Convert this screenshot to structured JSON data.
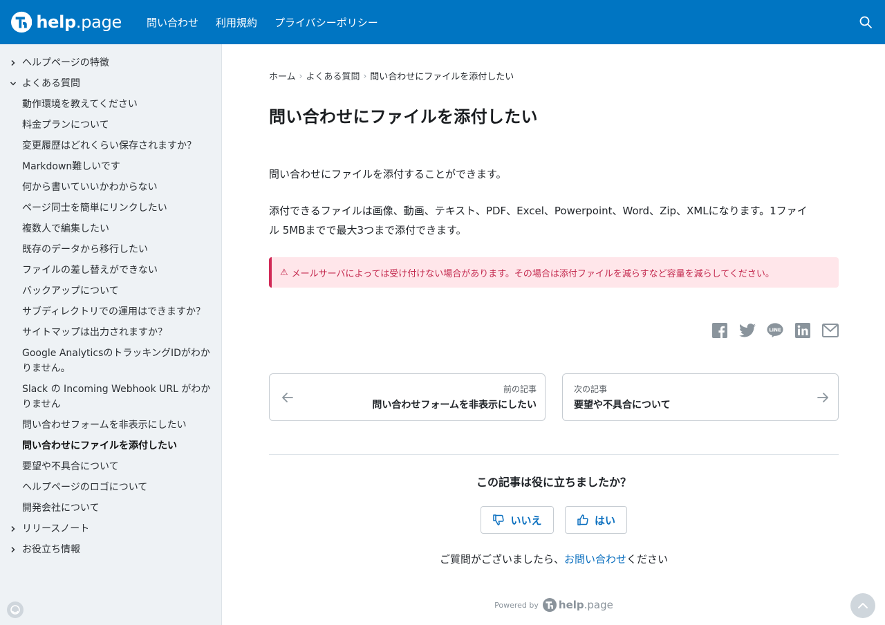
{
  "header": {
    "logo_text_bold": "help",
    "logo_text_rest": ".page",
    "nav": [
      "問い合わせ",
      "利用規約",
      "プライバシーポリシー"
    ],
    "search_icon": "search-icon",
    "bg_color": "#0075c2"
  },
  "sidebar": {
    "items": [
      {
        "label": "ヘルプページの特徴",
        "level": 0,
        "chevron": "right"
      },
      {
        "label": "よくある質問",
        "level": 0,
        "chevron": "down"
      },
      {
        "label": "動作環境を教えてください",
        "level": 1
      },
      {
        "label": "料金プランについて",
        "level": 1
      },
      {
        "label": "変更履歴はどれくらい保存されますか？",
        "level": 1
      },
      {
        "label": "Markdown難しいです",
        "level": 1
      },
      {
        "label": "何から書いていいかわからない",
        "level": 1
      },
      {
        "label": "ページ同士を簡単にリンクしたい",
        "level": 1
      },
      {
        "label": "複数人で編集したい",
        "level": 1
      },
      {
        "label": "既存のデータから移行したい",
        "level": 1
      },
      {
        "label": "ファイルの差し替えができない",
        "level": 1
      },
      {
        "label": "バックアップについて",
        "level": 1
      },
      {
        "label": "サブディレクトリでの運用はできますか？",
        "level": 1
      },
      {
        "label": "サイトマップは出力されますか？",
        "level": 1
      },
      {
        "label": "Google AnalyticsのトラッキングIDがわかりません。",
        "level": 1
      },
      {
        "label": "Slack の Incoming Webhook URL がわかりません",
        "level": 1
      },
      {
        "label": "問い合わせフォームを非表示にしたい",
        "level": 1
      },
      {
        "label": "問い合わせにファイルを添付したい",
        "level": 1,
        "active": true
      },
      {
        "label": "要望や不具合について",
        "level": 1
      },
      {
        "label": "ヘルプページのロゴについて",
        "level": 1
      },
      {
        "label": "開発会社について",
        "level": 1
      },
      {
        "label": "リリースノート",
        "level": 0,
        "chevron": "right"
      },
      {
        "label": "お役立ち情報",
        "level": 0,
        "chevron": "right"
      }
    ]
  },
  "breadcrumb": {
    "home": "ホーム",
    "section": "よくある質問",
    "current": "問い合わせにファイルを添付したい"
  },
  "article": {
    "title": "問い合わせにファイルを添付したい",
    "p1": "問い合わせにファイルを添付することができます。",
    "p2_line1": "添付できるファイルは画像、動画、テキスト、PDF、Excel、Powerpoint、Word、Zip、XMLになります。1ファイ",
    "p2_line2": "ル 5MBまでで最大3つまで添付できます。",
    "alert_icon": "⚠",
    "alert": "メールサーバによっては受け付けない場合があります。その場合は添付ファイルを減らすなど容量を減らしてください。",
    "alert_color": "#c4294e"
  },
  "share": [
    "facebook-icon",
    "twitter-icon",
    "line-icon",
    "linkedin-icon",
    "mail-icon"
  ],
  "share_line_text": "LINE",
  "pager": {
    "prev_label": "前の記事",
    "prev_title": "問い合わせフォームを非表示にしたい",
    "next_label": "次の記事",
    "next_title": "要望や不具合について"
  },
  "feedback": {
    "question": "この記事は役に立ちましたか？",
    "no": "いいえ",
    "yes": "はい",
    "contact_prefix": "ご質問がございましたら、",
    "contact_link": "お問い合わせ",
    "contact_suffix": "ください"
  },
  "footer": {
    "powered_by": "Powered by",
    "logo_bold": "help",
    "logo_rest": ".page"
  }
}
